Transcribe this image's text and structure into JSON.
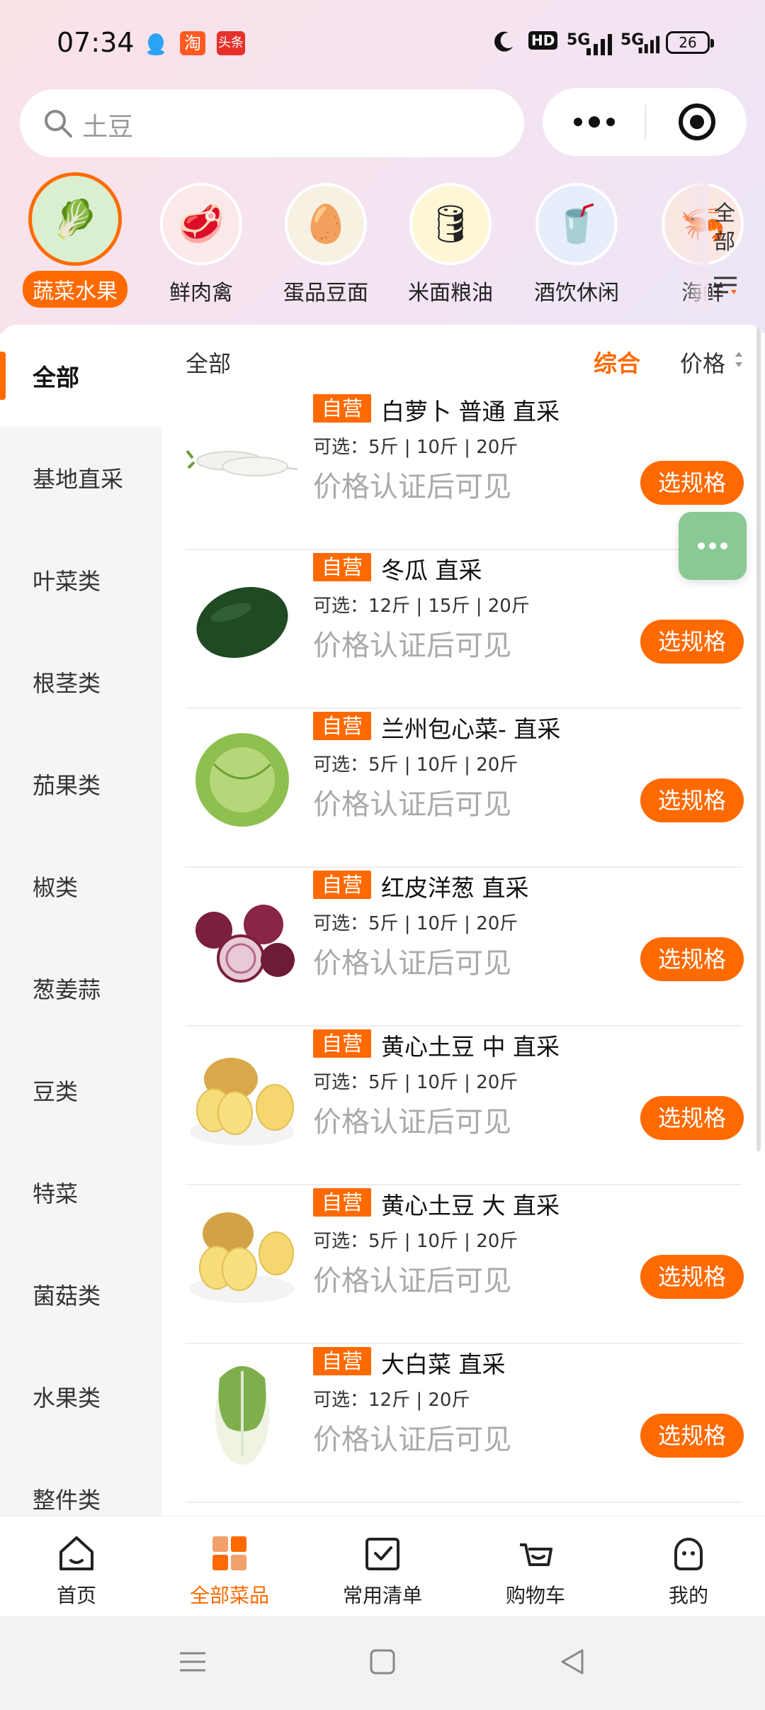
{
  "status_bar": {
    "time": "07:34",
    "tb_badge": "淘",
    "tt_badge": "头条",
    "hd": "HD",
    "net1": "5G",
    "net2": "5G",
    "battery": "26"
  },
  "search": {
    "placeholder": "土豆"
  },
  "categories": [
    {
      "label": "蔬菜水果",
      "icon": "vegetables-icon",
      "glyph": "🥬",
      "active": true
    },
    {
      "label": "鲜肉禽",
      "icon": "meat-icon",
      "glyph": "🥩"
    },
    {
      "label": "蛋品豆面",
      "icon": "tofu-egg-icon",
      "glyph": "🥚"
    },
    {
      "label": "米面粮油",
      "icon": "oil-icon",
      "glyph": "🛢"
    },
    {
      "label": "酒饮休闲",
      "icon": "drink-icon",
      "glyph": "🥤"
    },
    {
      "label": "海鲜",
      "icon": "seafood-icon",
      "glyph": "🦐"
    }
  ],
  "all_categories": {
    "line1": "全",
    "line2": "部"
  },
  "sidebar": [
    "全部",
    "基地直采",
    "叶菜类",
    "根茎类",
    "茄果类",
    "椒类",
    "葱姜蒜",
    "豆类",
    "特菜",
    "菌菇类",
    "水果类",
    "整件类"
  ],
  "filter": {
    "title": "全部",
    "combined": "综合",
    "price": "价格"
  },
  "products": [
    {
      "tag": "自营",
      "name": "白萝卜 普通 直采",
      "specs": "可选：5斤 | 10斤 | 20斤",
      "price_note": "价格认证后可见",
      "button": "选规格",
      "icon": "radish-icon",
      "color": "#eef0ec"
    },
    {
      "tag": "自营",
      "name": "冬瓜 直采",
      "specs": "可选：12斤 | 15斤 | 20斤",
      "price_note": "价格认证后可见",
      "button": "选规格",
      "icon": "wax-gourd-icon",
      "color": "#1f4a22"
    },
    {
      "tag": "自营",
      "name": "兰州包心菜- 直采",
      "specs": "可选：5斤 | 10斤 | 20斤",
      "price_note": "价格认证后可见",
      "button": "选规格",
      "icon": "cabbage-icon",
      "color": "#8fbf4e"
    },
    {
      "tag": "自营",
      "name": "红皮洋葱 直采",
      "specs": "可选：5斤 | 10斤 | 20斤",
      "price_note": "价格认证后可见",
      "button": "选规格",
      "icon": "onion-icon",
      "color": "#7a1f3e"
    },
    {
      "tag": "自营",
      "name": "黄心土豆 中 直采",
      "specs": "可选：5斤 | 10斤 | 20斤",
      "price_note": "价格认证后可见",
      "button": "选规格",
      "icon": "potato-icon",
      "color": "#e9c45a"
    },
    {
      "tag": "自营",
      "name": "黄心土豆 大 直采",
      "specs": "可选：5斤 | 10斤 | 20斤",
      "price_note": "价格认证后可见",
      "button": "选规格",
      "icon": "potato-icon",
      "color": "#e5bf55"
    },
    {
      "tag": "自营",
      "name": "大白菜 直采",
      "specs": "可选：12斤 | 20斤",
      "price_note": "价格认证后可见",
      "button": "选规格",
      "icon": "napa-cabbage-icon",
      "color": "#b9d79a"
    }
  ],
  "bottom_nav": [
    {
      "label": "首页",
      "icon": "home-icon"
    },
    {
      "label": "全部菜品",
      "icon": "grid-icon",
      "active": true
    },
    {
      "label": "常用清单",
      "icon": "list-check-icon"
    },
    {
      "label": "购物车",
      "icon": "cart-icon"
    },
    {
      "label": "我的",
      "icon": "profile-icon"
    }
  ],
  "accent": "#ff6a00"
}
